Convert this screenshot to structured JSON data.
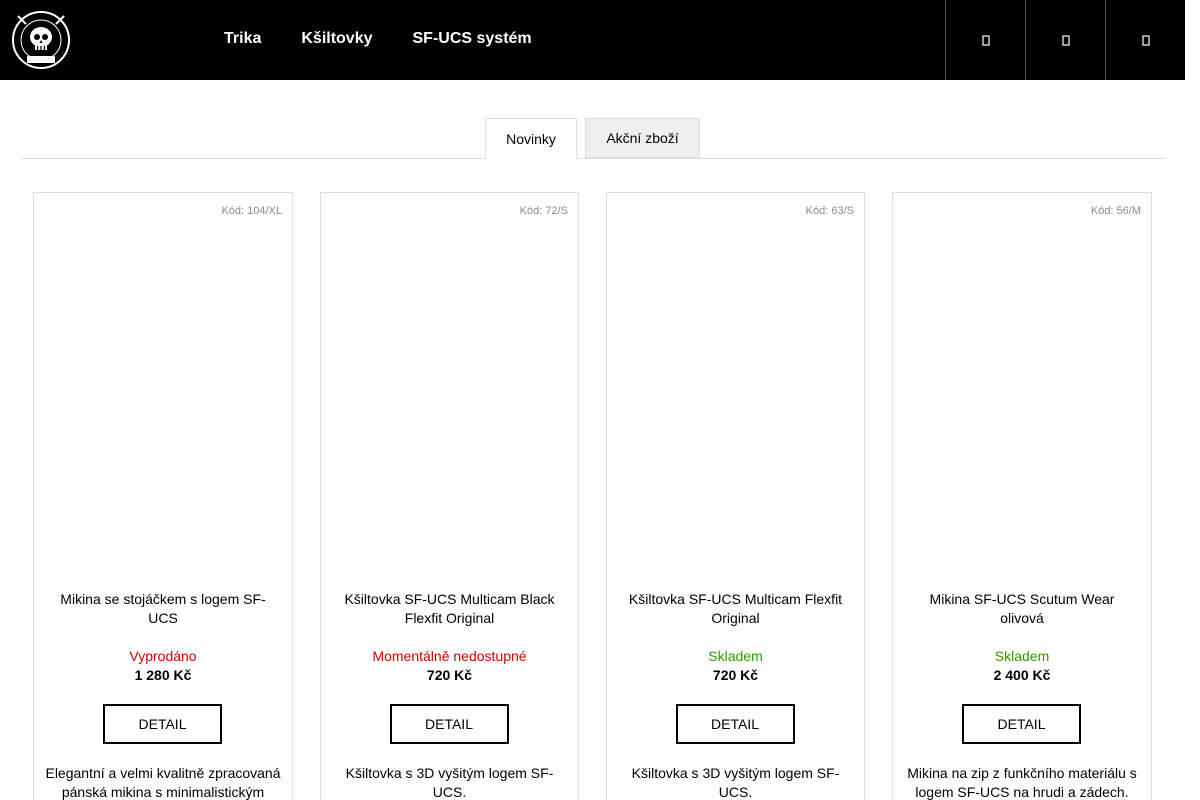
{
  "header": {
    "nav": [
      {
        "label": "Trika"
      },
      {
        "label": "Kšiltovky"
      },
      {
        "label": "SF-UCS systém"
      }
    ],
    "buttons": [
      "search-icon",
      "user-icon",
      "cart-icon"
    ]
  },
  "tabs": [
    {
      "label": "Novinky",
      "active": true
    },
    {
      "label": "Akční zboží",
      "active": false
    }
  ],
  "colors": {
    "sold_out": "#d10000",
    "in_stock": "#2a9d00",
    "header_bg": "#000000"
  },
  "products": [
    {
      "code": "Kód: 104/XL",
      "name": "Mikina se stojáčkem s logem SF-UCS",
      "availability": "Vyprodáno",
      "availability_color": "red",
      "price": "1 280 Kč",
      "detail_label": "DETAIL",
      "description": "Elegantní a velmi kvalitně zpracovaná pánská mikina s minimalistickým"
    },
    {
      "code": "Kód: 72/S",
      "name": "Kšiltovka SF-UCS Multicam Black Flexfit Original",
      "availability": "Momentálně nedostupné",
      "availability_color": "red",
      "price": "720 Kč",
      "detail_label": "DETAIL",
      "description": "Kšiltovka s 3D vyšitým logem SF-UCS."
    },
    {
      "code": "Kód: 63/S",
      "name": "Kšiltovka SF-UCS Multicam Flexfit Original",
      "availability": "Skladem",
      "availability_color": "green",
      "price": "720 Kč",
      "detail_label": "DETAIL",
      "description": "Kšiltovka s 3D vyšitým logem SF-UCS."
    },
    {
      "code": "Kód: 56/M",
      "name": "Mikina SF-UCS Scutum Wear olivová",
      "availability": "Skladem",
      "availability_color": "green",
      "price": "2 400 Kč",
      "detail_label": "DETAIL",
      "description": "Mikina na zip z funkčního materiálu s logem SF-UCS na hrudi a zádech."
    }
  ]
}
